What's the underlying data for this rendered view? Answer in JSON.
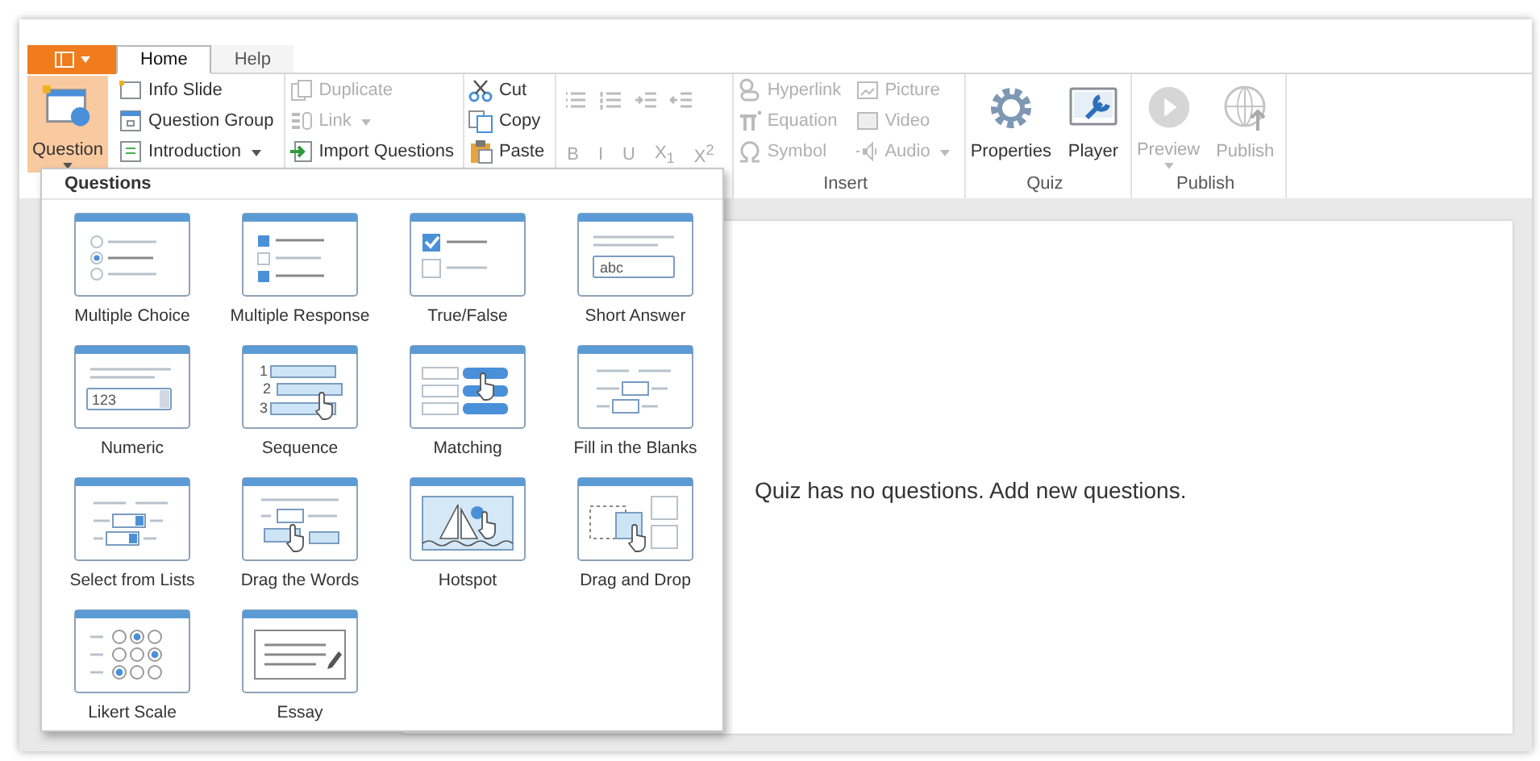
{
  "app_menu": {
    "dropdown": true
  },
  "tabs": [
    {
      "label": "Home",
      "selected": true
    },
    {
      "label": "Help",
      "selected": false
    }
  ],
  "ribbon": {
    "groups": [
      {
        "columns": [
          [
            {
              "label": "Question",
              "kind": "large",
              "pressed": true,
              "disabled": false,
              "dropdown": true
            }
          ],
          [
            {
              "label": "Info Slide",
              "kind": "small",
              "disabled": false,
              "dropdown": false
            },
            {
              "label": "Question Group",
              "kind": "small",
              "disabled": false,
              "dropdown": false
            },
            {
              "label": "Introduction",
              "kind": "small",
              "disabled": false,
              "dropdown": true
            }
          ]
        ]
      },
      {
        "columns": [
          [
            {
              "label": "Duplicate",
              "kind": "small",
              "disabled": true,
              "dropdown": false
            },
            {
              "label": "Link",
              "kind": "small",
              "disabled": true,
              "dropdown": true
            },
            {
              "label": "Import Questions",
              "kind": "small",
              "disabled": false,
              "dropdown": false
            }
          ]
        ]
      },
      {
        "columns": [
          [
            {
              "label": "Cut",
              "kind": "small",
              "disabled": false,
              "dropdown": false
            },
            {
              "label": "Copy",
              "kind": "small",
              "disabled": false,
              "dropdown": false
            },
            {
              "label": "Paste",
              "kind": "small",
              "disabled": false,
              "dropdown": false
            }
          ]
        ]
      },
      {
        "columns": [
          [
            {
              "kind": "icon",
              "disabled": true
            },
            {
              "kind": "icon",
              "disabled": true
            },
            {
              "kind": "icon",
              "disabled": true
            },
            {
              "kind": "icon",
              "disabled": true
            }
          ],
          [
            {
              "label": "B",
              "kind": "format",
              "disabled": true
            },
            {
              "label": "I",
              "kind": "format",
              "disabled": true
            },
            {
              "label": "U",
              "kind": "format",
              "disabled": true
            },
            {
              "label": "X$_{1}$",
              "kind": "format",
              "disabled": true
            },
            {
              "label": "X$^{2}$",
              "kind": "format",
              "disabled": true
            }
          ]
        ]
      },
      {
        "label": "Insert",
        "columns": [
          [
            {
              "label": "Hyperlink",
              "kind": "small",
              "disabled": true,
              "dropdown": false
            },
            {
              "label": "Equation",
              "kind": "small",
              "disabled": true,
              "dropdown": false
            },
            {
              "label": "Symbol",
              "kind": "small",
              "disabled": true,
              "dropdown": false
            }
          ],
          [
            {
              "label": "Picture",
              "kind": "small",
              "disabled": true,
              "dropdown": false
            },
            {
              "label": "Video",
              "kind": "small",
              "disabled": true,
              "dropdown": false
            },
            {
              "label": "Audio",
              "kind": "small",
              "disabled": true,
              "dropdown": true
            }
          ]
        ]
      },
      {
        "label": "Quiz",
        "columns": [
          [
            {
              "label": "Properties",
              "kind": "large",
              "pressed": false,
              "disabled": false,
              "dropdown": false
            }
          ],
          [
            {
              "label": "Player",
              "kind": "large",
              "pressed": false,
              "disabled": false,
              "dropdown": false
            }
          ]
        ]
      },
      {
        "label": "Publish",
        "columns": [
          [
            {
              "label": "Preview",
              "kind": "large",
              "pressed": false,
              "disabled": true,
              "dropdown": true
            }
          ],
          [
            {
              "label": "Publish",
              "kind": "large",
              "pressed": false,
              "disabled": true,
              "dropdown": false
            }
          ]
        ]
      }
    ]
  },
  "questions_menu": {
    "title": "Questions",
    "items": [
      {
        "label": "Multiple Choice"
      },
      {
        "label": "Multiple Response"
      },
      {
        "label": "True/False"
      },
      {
        "label": "Short Answer",
        "samples": [
          "abc"
        ]
      },
      {
        "label": "Numeric",
        "samples": [
          "123"
        ]
      },
      {
        "label": "Sequence",
        "samples": [
          "1",
          "2",
          "3"
        ]
      },
      {
        "label": "Matching"
      },
      {
        "label": "Fill in the Blanks"
      },
      {
        "label": "Select from Lists"
      },
      {
        "label": "Drag the Words"
      },
      {
        "label": "Hotspot"
      },
      {
        "label": "Drag and Drop"
      },
      {
        "label": "Likert Scale"
      },
      {
        "label": "Essay"
      }
    ]
  },
  "slide": {
    "message": "Quiz has no questions. Add new questions."
  }
}
